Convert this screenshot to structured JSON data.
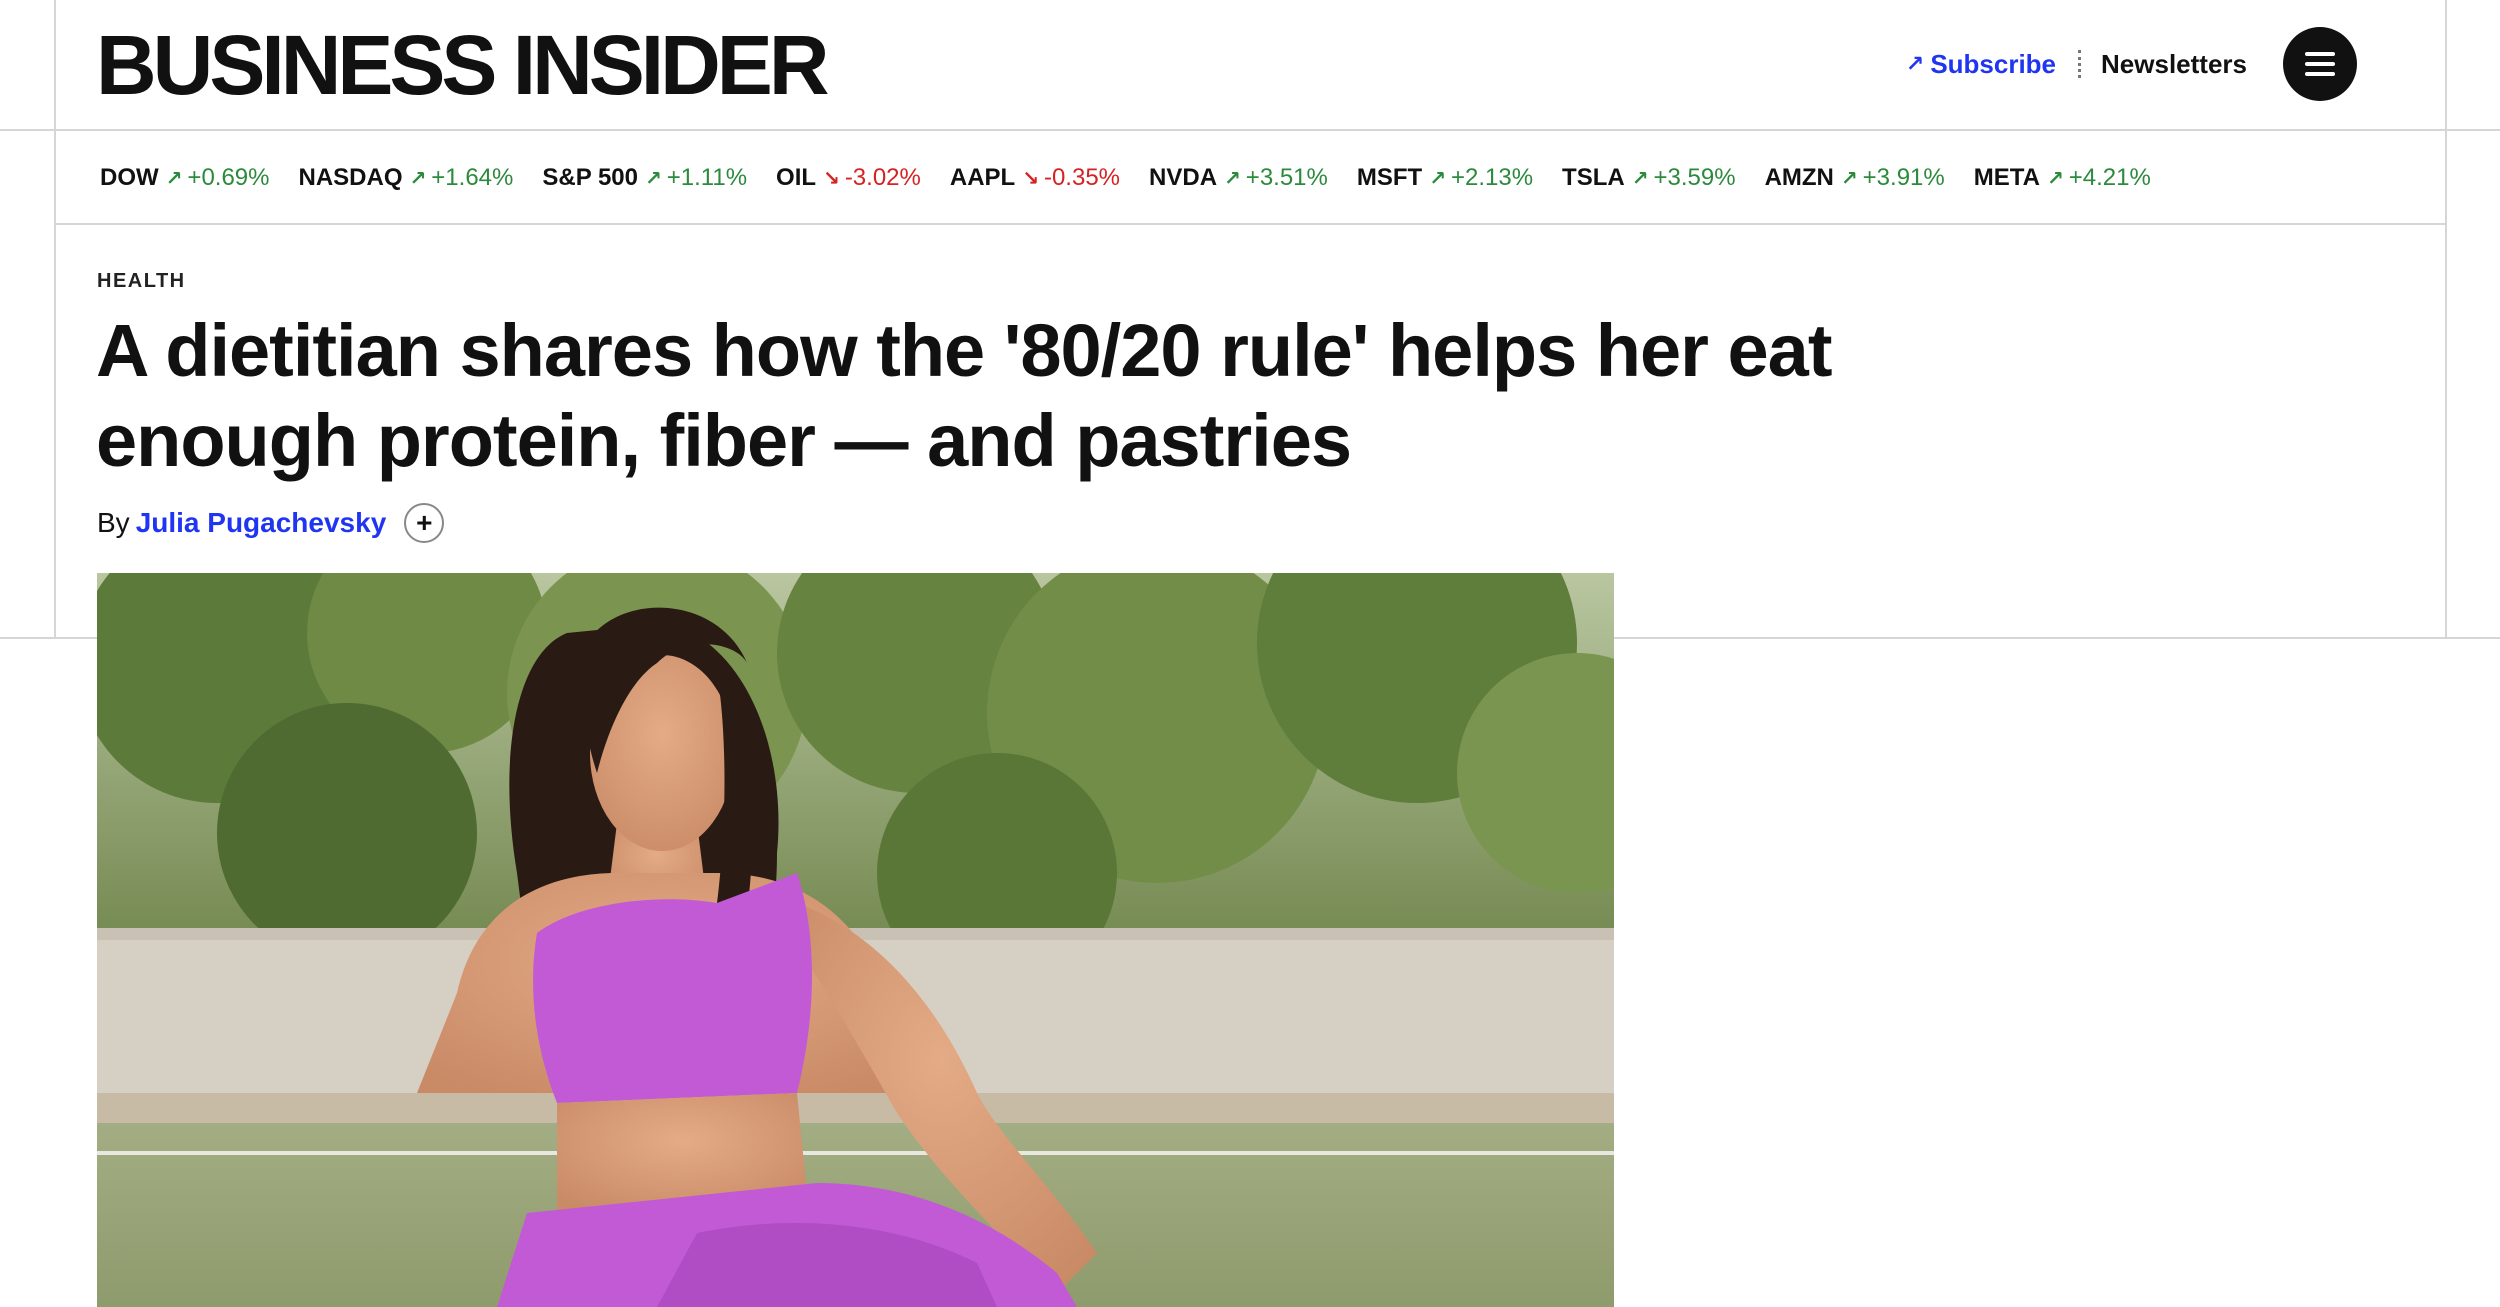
{
  "header": {
    "logo": "BUSINESS INSIDER",
    "subscribe_icon": "arrow-up-right-icon",
    "subscribe_label": "Subscribe",
    "newsletters_label": "Newsletters",
    "menu_icon": "hamburger-menu-icon"
  },
  "ticker": [
    {
      "symbol": "DOW",
      "change": "+0.69%",
      "direction": "up"
    },
    {
      "symbol": "NASDAQ",
      "change": "+1.64%",
      "direction": "up"
    },
    {
      "symbol": "S&P 500",
      "change": "+1.11%",
      "direction": "up"
    },
    {
      "symbol": "OIL",
      "change": "-3.02%",
      "direction": "down"
    },
    {
      "symbol": "AAPL",
      "change": "-0.35%",
      "direction": "down"
    },
    {
      "symbol": "NVDA",
      "change": "+3.51%",
      "direction": "up"
    },
    {
      "symbol": "MSFT",
      "change": "+2.13%",
      "direction": "up"
    },
    {
      "symbol": "TSLA",
      "change": "+3.59%",
      "direction": "up"
    },
    {
      "symbol": "AMZN",
      "change": "+3.91%",
      "direction": "up"
    },
    {
      "symbol": "META",
      "change": "+4.21%",
      "direction": "up"
    }
  ],
  "article": {
    "category": "HEALTH",
    "headline": "A dietitian shares how the '80/20 rule' helps her eat enough protein, fiber — and pastries",
    "byline_prefix": "By",
    "author": "Julia Pugachevsky",
    "follow_symbol": "+"
  },
  "colors": {
    "link_blue": "#1f35f2",
    "up_green": "#2c8a3c",
    "down_red": "#d62222",
    "outfit_magenta": "#c25ad6"
  }
}
